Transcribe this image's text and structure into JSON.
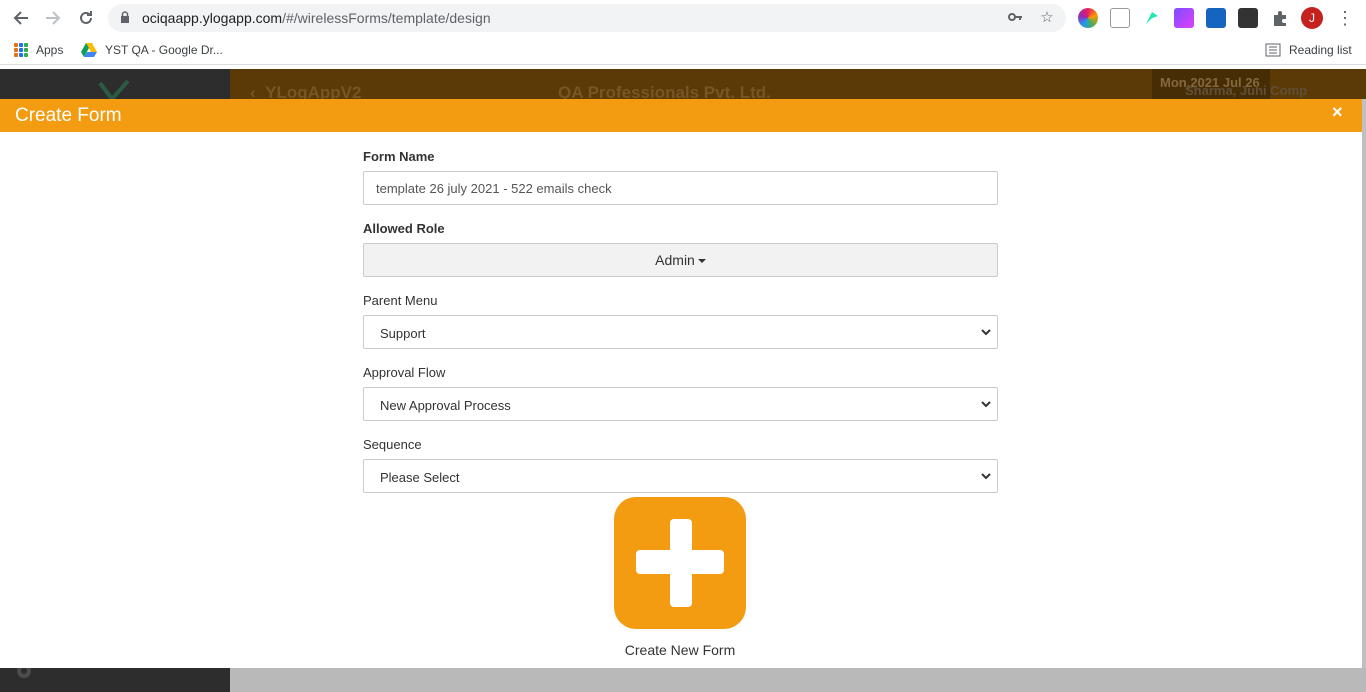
{
  "browser": {
    "url_host": "ociqaapp.ylogapp.com",
    "url_path": "/#/wirelessForms/template/design",
    "profile_initial": "J",
    "bookmarks": [
      {
        "label": "Apps"
      },
      {
        "label": "YST QA - Google Dr..."
      }
    ],
    "reading_list_label": "Reading list"
  },
  "app": {
    "title": "YLogAppV2",
    "company": "QA Professionals Pvt. Ltd.",
    "date": "Mon,2021 Jul 26",
    "notification_count": "0",
    "user": "Sharma, Juhi Comp"
  },
  "modal": {
    "title": "Create Form",
    "close_symbol": "×",
    "form_name_label": "Form Name",
    "form_name_value": "template 26 july 2021 - 522 emails check",
    "allowed_role_label": "Allowed Role",
    "allowed_role_value": "Admin",
    "parent_menu_label": "Parent Menu",
    "parent_menu_value": "Support",
    "approval_flow_label": "Approval Flow",
    "approval_flow_value": "New Approval Process",
    "sequence_label": "Sequence",
    "sequence_value": "Please Select",
    "create_new_label": "Create New Form",
    "accent_color": "#f39c12"
  }
}
